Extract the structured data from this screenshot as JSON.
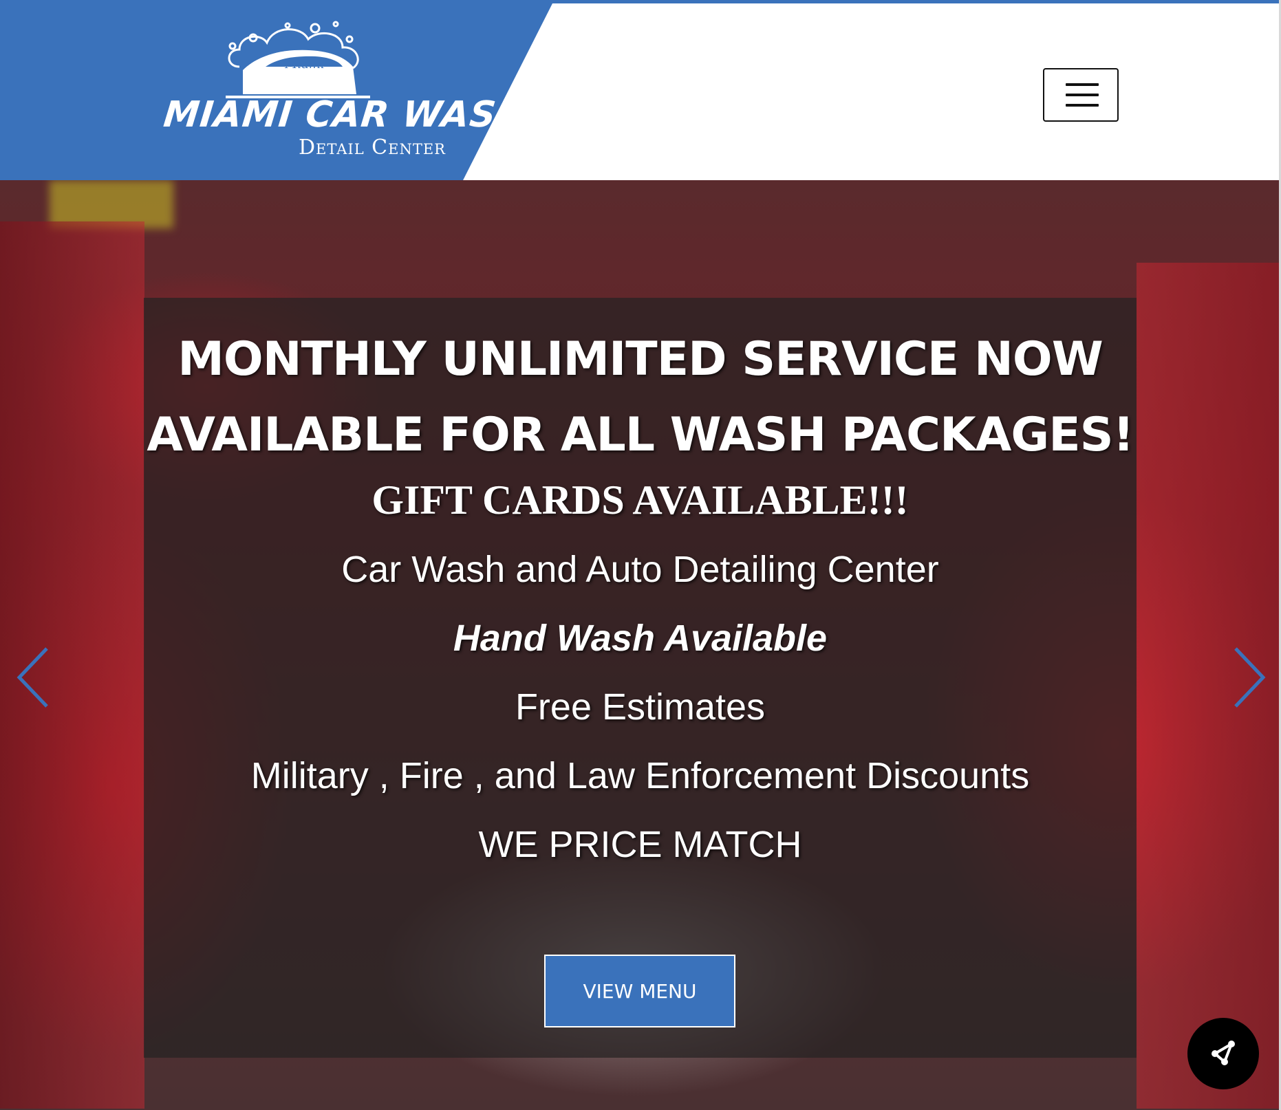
{
  "header": {
    "logo_script": "Miami",
    "logo_title": "MIAMI CAR WASH",
    "logo_subtitle": "Detail Center",
    "menu_icon": "hamburger-menu-icon",
    "brand_color": "#3a72bb"
  },
  "hero": {
    "headline_line1": "MONTHLY UNLIMITED SERVICE NOW",
    "headline_line2": "AVAILABLE FOR ALL WASH PACKAGES!",
    "gift_cards": "GIFT CARDS AVAILABLE!!!",
    "line_services": "Car Wash and Auto Detailing  Center",
    "line_hand_wash": "Hand Wash Available",
    "line_estimates": "Free Estimates",
    "line_discounts": "Military , Fire , and Law Enforcement Discounts",
    "line_price_match": "WE PRICE MATCH",
    "cta_label": "VIEW MENU",
    "prev_icon": "chevron-left-icon",
    "next_icon": "chevron-right-icon",
    "arrow_color": "#3a72bb"
  },
  "share": {
    "icon": "share-icon"
  }
}
